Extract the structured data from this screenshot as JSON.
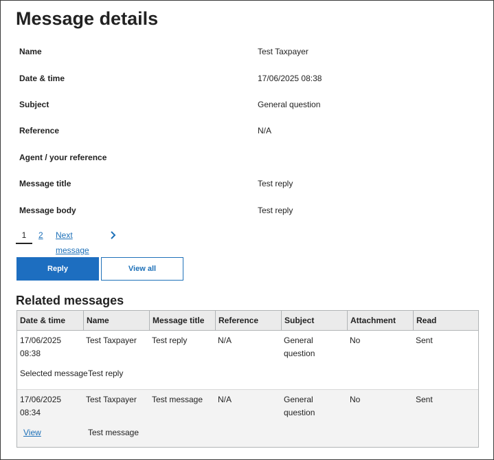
{
  "page": {
    "title": "Message details"
  },
  "details": [
    {
      "label": "Name",
      "value": "Test Taxpayer"
    },
    {
      "label": "Date & time",
      "value": "17/06/2025 08:38"
    },
    {
      "label": "Subject",
      "value": "General question"
    },
    {
      "label": "Reference",
      "value": "N/A"
    },
    {
      "label": "Agent / your reference",
      "value": ""
    },
    {
      "label": "Message title",
      "value": "Test reply"
    },
    {
      "label": "Message body",
      "value": "Test reply"
    }
  ],
  "pagination": {
    "current": "1",
    "page2": "2",
    "next_label": "Next message"
  },
  "actions": {
    "reply": "Reply",
    "view_all": "View all"
  },
  "related": {
    "title": "Related messages",
    "columns": [
      "Date & time",
      "Name",
      "Message title",
      "Reference",
      "Subject",
      "Attachment",
      "Read"
    ],
    "rows": [
      {
        "date": "17/06/2025",
        "time": "08:38",
        "name": "Test Taxpayer",
        "title": "Test reply",
        "reference": "N/A",
        "subject_1": "General",
        "subject_2": "question",
        "attachment": "No",
        "read": "Sent",
        "extra_label": "Selected message",
        "extra_value": "Test reply"
      },
      {
        "date": "17/06/2025",
        "time": "08:34",
        "name": "Test Taxpayer",
        "title": "Test message",
        "reference": "N/A",
        "subject_1": "General",
        "subject_2": "question",
        "attachment": "No",
        "read": "Sent",
        "extra_label": "View",
        "extra_value": "Test message"
      }
    ]
  },
  "colors": {
    "link": "#1d70b8",
    "primary_button": "#1d6ec0",
    "header_bg": "#ebebeb"
  }
}
